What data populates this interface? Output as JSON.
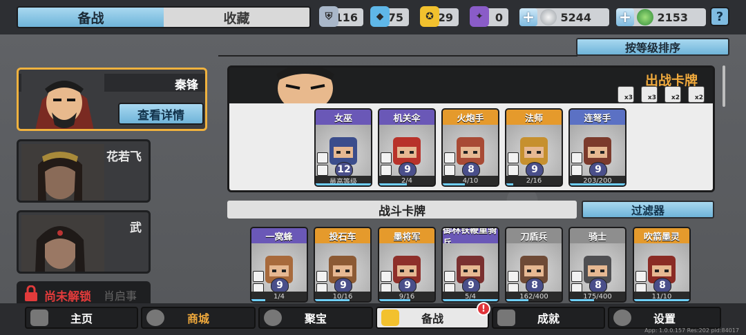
{
  "tabs": [
    {
      "label": "备战",
      "active": true
    },
    {
      "label": "收藏",
      "active": false
    }
  ],
  "resources": [
    {
      "icon": "silver-shield-icon",
      "value": "116",
      "color": "#a9b7c9"
    },
    {
      "icon": "blue-crystal-icon",
      "value": "75",
      "color": "#5fb7e8"
    },
    {
      "icon": "gold-emblem-icon",
      "value": "29",
      "color": "#f2c12e"
    },
    {
      "icon": "purple-rune-icon",
      "value": "0",
      "color": "#8a5cc8"
    },
    {
      "icon": "silver-coin-icon",
      "value": "5244",
      "color": "#d6d9dd"
    },
    {
      "icon": "jade-coin-icon",
      "value": "2153",
      "color": "#3aa94a"
    }
  ],
  "help_label": "?",
  "sort_label": "按等级排序",
  "heroes": [
    {
      "name": "秦锋",
      "detail_label": "查看详情",
      "selected": true
    },
    {
      "name": "花若飞",
      "selected": false
    },
    {
      "name": "武",
      "selected": false
    }
  ],
  "locked": {
    "label": "尚未解锁",
    "name": "肖启事"
  },
  "deck": {
    "title": "出战卡牌",
    "counters": [
      "x3",
      "x3",
      "x2",
      "x2"
    ],
    "cards": [
      {
        "name": "女巫",
        "level": "12",
        "progress": "最高等级",
        "fill": 1.0,
        "rarity": "purple",
        "art": "#3b4d8c"
      },
      {
        "name": "机关伞",
        "level": "9",
        "progress": "2/4",
        "fill": 0.5,
        "rarity": "purple",
        "art": "#b8322a"
      },
      {
        "name": "火炮手",
        "level": "8",
        "progress": "4/10",
        "fill": 0.4,
        "rarity": "orange",
        "art": "#a84a35"
      },
      {
        "name": "法师",
        "level": "9",
        "progress": "2/16",
        "fill": 0.125,
        "rarity": "orange",
        "art": "#c6902f"
      },
      {
        "name": "连弩手",
        "level": "9",
        "progress": "203/200",
        "fill": 1.0,
        "rarity": "blue",
        "art": "#7b3a2c"
      }
    ]
  },
  "battle": {
    "label": "战斗卡牌",
    "filter_label": "过滤器"
  },
  "battle_cards": [
    {
      "name": "一窝蜂",
      "level": "9",
      "progress": "1/4",
      "fill": 0.25,
      "rarity": "purple",
      "art": "#a86a3c"
    },
    {
      "name": "投石车",
      "level": "9",
      "progress": "10/16",
      "fill": 0.62,
      "rarity": "orange",
      "art": "#8c5a34"
    },
    {
      "name": "墨将军",
      "level": "9",
      "progress": "9/16",
      "fill": 0.56,
      "rarity": "orange",
      "art": "#8e2f2a"
    },
    {
      "name": "御林铁鞭重骑兵",
      "level": "9",
      "progress": "5/4",
      "fill": 1.0,
      "rarity": "purple",
      "art": "#7a3030"
    },
    {
      "name": "刀盾兵",
      "level": "8",
      "progress": "162/400",
      "fill": 0.4,
      "rarity": "gray",
      "art": "#6e4a36"
    },
    {
      "name": "骑士",
      "level": "8",
      "progress": "175/400",
      "fill": 0.44,
      "rarity": "gray",
      "art": "#4f4f52"
    },
    {
      "name": "吹箭墨灵",
      "level": "8",
      "progress": "11/10",
      "fill": 1.0,
      "rarity": "orange",
      "art": "#8a2b25"
    }
  ],
  "nav": [
    {
      "label": "主页",
      "icon": "house-icon",
      "active": false
    },
    {
      "label": "商城",
      "icon": "coins-icon",
      "active": false,
      "color": "#f0a93c"
    },
    {
      "label": "聚宝",
      "icon": "treasure-bowl-icon",
      "active": false
    },
    {
      "label": "备战",
      "icon": "card-icon",
      "active": true
    },
    {
      "label": "成就",
      "icon": "achievement-icon",
      "active": false
    },
    {
      "label": "设置",
      "icon": "gear-icon",
      "active": false
    }
  ],
  "nav_badge": "!",
  "version": "App: 1.0.0.157  Res:202 pid:84017"
}
